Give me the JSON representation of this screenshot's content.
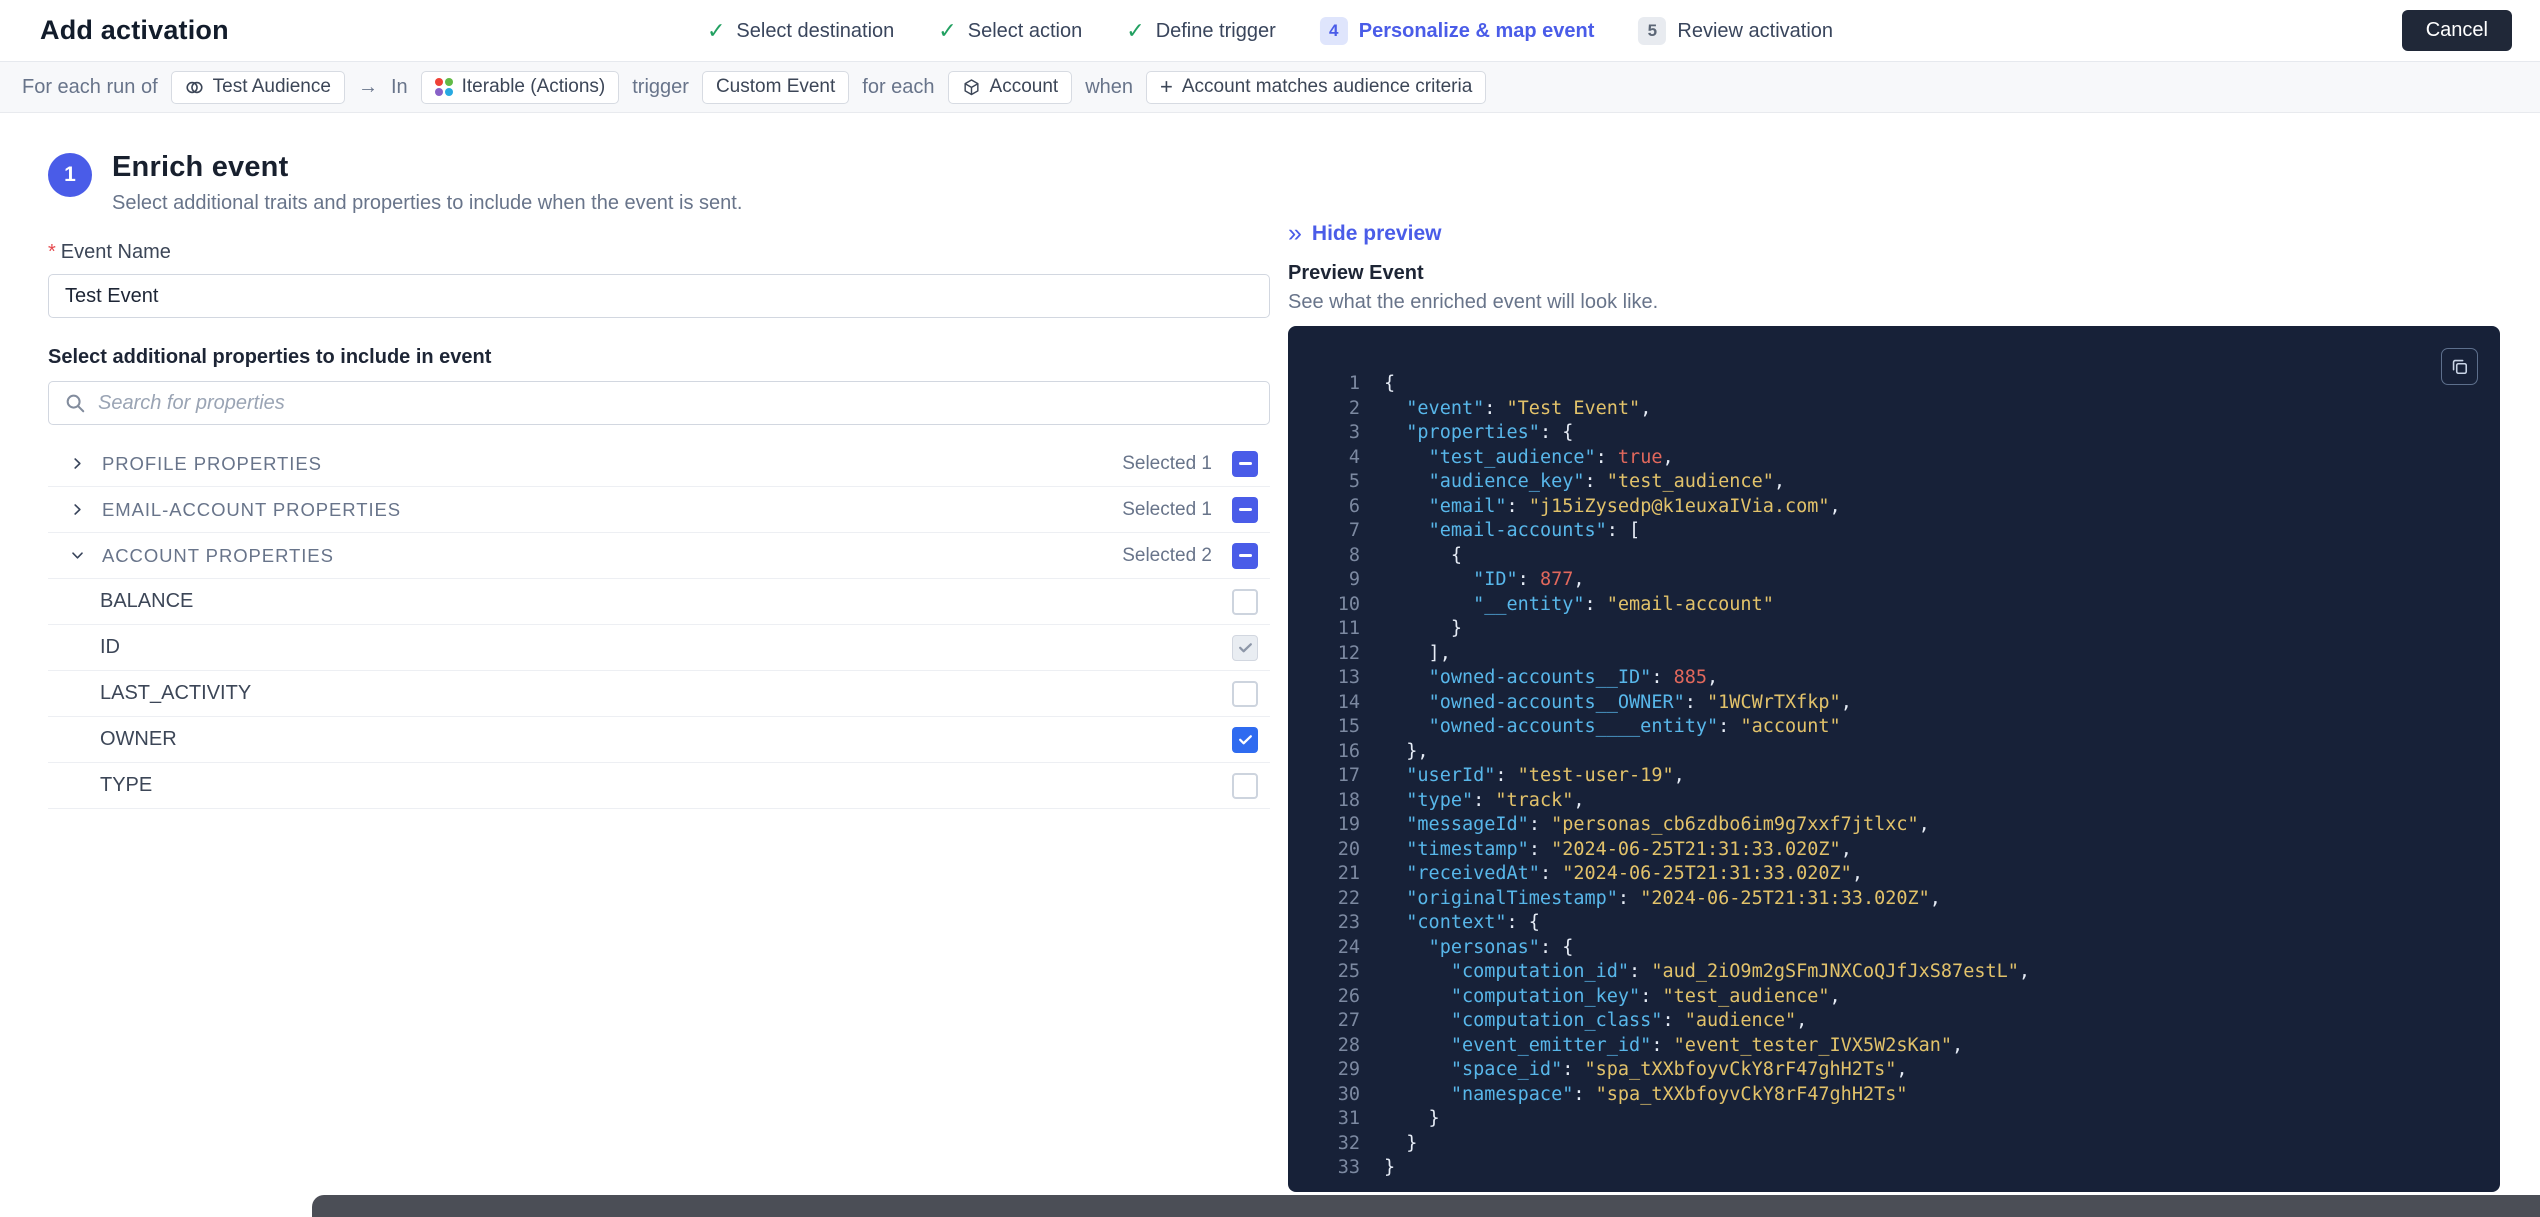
{
  "colors": {
    "accent": "#4a5ce8",
    "success": "#22a061",
    "checkbox_checked": "#2f6bf0",
    "code_bg": "#172138",
    "code_key": "#58b7ea",
    "code_string": "#e2c26a",
    "code_number": "#e2685c"
  },
  "icons": {
    "check": "✓",
    "chevrons_right": "»"
  },
  "header": {
    "title": "Add activation",
    "cancel_label": "Cancel",
    "steps": [
      {
        "label": "Select destination",
        "status": "done"
      },
      {
        "label": "Select action",
        "status": "done"
      },
      {
        "label": "Define trigger",
        "status": "done"
      },
      {
        "label": "Personalize & map event",
        "status": "active",
        "number": "4"
      },
      {
        "label": "Review activation",
        "status": "upcoming",
        "number": "5"
      }
    ]
  },
  "sentence": {
    "parts": [
      {
        "type": "text",
        "text": "For each run of"
      },
      {
        "type": "chip",
        "text": "Test Audience",
        "icon": "audience-icon"
      },
      {
        "type": "text",
        "text": "→"
      },
      {
        "type": "text",
        "text": "In"
      },
      {
        "type": "chip",
        "text": "Iterable (Actions)",
        "icon": "iterable-icon"
      },
      {
        "type": "text",
        "text": "trigger"
      },
      {
        "type": "chip",
        "text": "Custom Event"
      },
      {
        "type": "text",
        "text": "for each"
      },
      {
        "type": "chip",
        "text": "Account",
        "icon": "cube-icon"
      },
      {
        "type": "text",
        "text": "when"
      },
      {
        "type": "chip",
        "text": "Account matches audience criteria",
        "icon": "plus-icon",
        "interactable": true
      }
    ]
  },
  "enrich": {
    "step_number": "1",
    "title": "Enrich event",
    "subtitle": "Select additional traits and properties to include when the event is sent.",
    "required_marker": "*",
    "event_name_label": "Event Name",
    "event_name_value": "Test Event",
    "properties_label": "Select additional properties to include in event",
    "search_placeholder": "Search for properties"
  },
  "properties": {
    "sections": [
      {
        "label": "PROFILE PROPERTIES",
        "selected": "Selected 1",
        "expanded": false,
        "checkbox": "indeterminate",
        "children": []
      },
      {
        "label": "EMAIL-ACCOUNT PROPERTIES",
        "selected": "Selected 1",
        "expanded": false,
        "checkbox": "indeterminate",
        "children": []
      },
      {
        "label": "ACCOUNT PROPERTIES",
        "selected": "Selected 2",
        "expanded": true,
        "checkbox": "indeterminate",
        "children": [
          {
            "label": "BALANCE",
            "checkbox": "unchecked"
          },
          {
            "label": "ID",
            "checkbox": "checked-muted"
          },
          {
            "label": "LAST_ACTIVITY",
            "checkbox": "unchecked"
          },
          {
            "label": "OWNER",
            "checkbox": "checked"
          },
          {
            "label": "TYPE",
            "checkbox": "unchecked"
          }
        ]
      }
    ]
  },
  "preview": {
    "hide_label": "Hide preview",
    "title": "Preview Event",
    "subtitle": "See what the enriched event will look like.",
    "code_lines": [
      "{",
      "  \"event\": \"Test Event\",",
      "  \"properties\": {",
      "    \"test_audience\": true,",
      "    \"audience_key\": \"test_audience\",",
      "    \"email\": \"j15iZysedp@k1euxaIVia.com\",",
      "    \"email-accounts\": [",
      "      {",
      "        \"ID\": 877,",
      "        \"__entity\": \"email-account\"",
      "      }",
      "    ],",
      "    \"owned-accounts__ID\": 885,",
      "    \"owned-accounts__OWNER\": \"1WCWrTXfkp\",",
      "    \"owned-accounts____entity\": \"account\"",
      "  },",
      "  \"userId\": \"test-user-19\",",
      "  \"type\": \"track\",",
      "  \"messageId\": \"personas_cb6zdbo6im9g7xxf7jtlxc\",",
      "  \"timestamp\": \"2024-06-25T21:31:33.020Z\",",
      "  \"receivedAt\": \"2024-06-25T21:31:33.020Z\",",
      "  \"originalTimestamp\": \"2024-06-25T21:31:33.020Z\",",
      "  \"context\": {",
      "    \"personas\": {",
      "      \"computation_id\": \"aud_2iO9m2gSFmJNXCoQJfJxS87estL\",",
      "      \"computation_key\": \"test_audience\",",
      "      \"computation_class\": \"audience\",",
      "      \"event_emitter_id\": \"event_tester_IVX5W2sKan\",",
      "      \"space_id\": \"spa_tXXbfoyvCkY8rF47ghH2Ts\",",
      "      \"namespace\": \"spa_tXXbfoyvCkY8rF47ghH2Ts\"",
      "    }",
      "  }",
      "}"
    ]
  }
}
